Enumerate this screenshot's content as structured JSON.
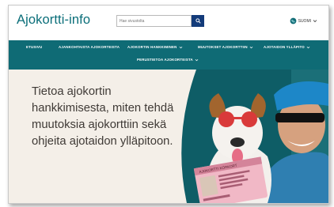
{
  "header": {
    "logo": "Ajokortti-info",
    "search_placeholder": "Hae sivustolta",
    "language": "SUOMI"
  },
  "nav": {
    "items": [
      "ETUSIVU",
      "AJANKOHTAISTA AJOKORTEISTA",
      "AJOKORTIN HANKKIMINEN",
      "MUUTOKSET AJOKORTTIIN",
      "AJOTAIDON YLLÄPITO",
      "PERUSTIETOA AJOKORTEISTA"
    ]
  },
  "hero": {
    "text": "Tietoa ajokortin hankkimisesta, miten tehdä muutoksia ajokorttiin sekä ohjeita ajotaidon ylläpitoon."
  },
  "photo": {
    "card_text": "AJOKORTTI KÖRKORT"
  },
  "colors": {
    "brand": "#0a6e79",
    "nav_bg": "#0f6b75",
    "search_button": "#133b7a",
    "hero_bg": "#f4efe8"
  }
}
